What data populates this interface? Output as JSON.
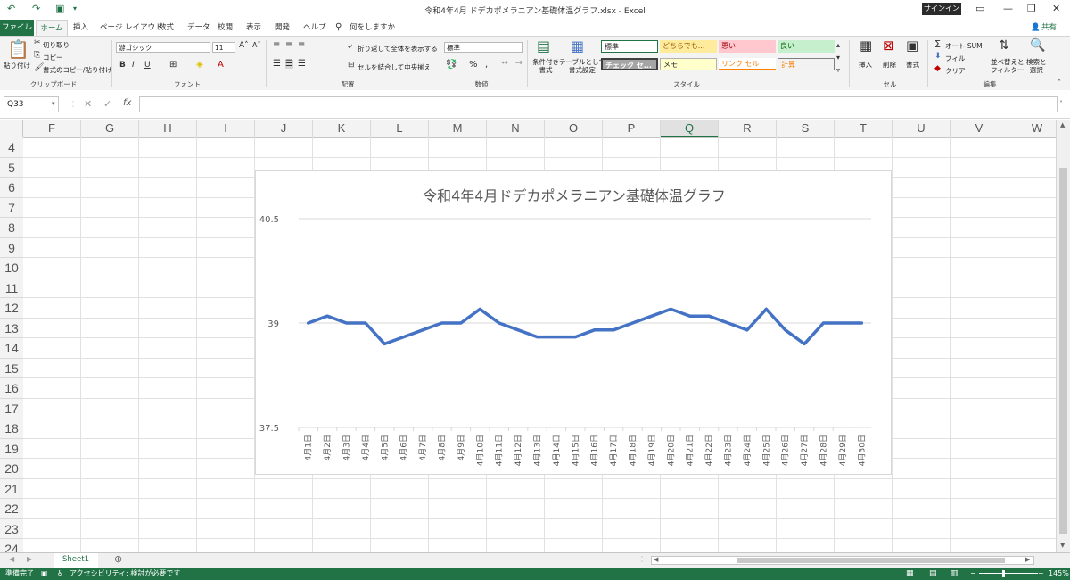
{
  "window": {
    "title": "令和4年4月 ドデカポメラニアン基礎体温グラフ.xlsx  -  Excel",
    "signin": "サインイン",
    "share": "共有"
  },
  "tabs": [
    "ファイル",
    "ホーム",
    "挿入",
    "ページ レイアウト",
    "数式",
    "データ",
    "校閲",
    "表示",
    "開発",
    "ヘルプ",
    "何をしますか"
  ],
  "ribbon": {
    "clipboard": {
      "paste": "貼り付け",
      "cut": "切り取り",
      "copy": "コピー",
      "format_painter": "書式のコピー/貼り付け",
      "label": "クリップボード"
    },
    "font": {
      "name": "游ゴシック",
      "size": "11",
      "label": "フォント"
    },
    "alignment": {
      "wrap": "折り返して全体を表示する",
      "merge": "セルを結合して中央揃え",
      "label": "配置"
    },
    "number": {
      "format": "標準",
      "label": "数値"
    },
    "styles": {
      "conditional": "条件付き\n書式",
      "table": "テーブルとして\n書式設定",
      "label": "スタイル",
      "cells": [
        "標準",
        "どちらでも...",
        "悪い",
        "良い",
        "チェック セ...",
        "メモ",
        "リンク セル",
        "計算"
      ]
    },
    "cells": {
      "insert": "挿入",
      "delete": "削除",
      "format": "書式",
      "label": "セル"
    },
    "editing": {
      "autosum": "オート SUM",
      "fill": "フィル",
      "clear": "クリア",
      "sort": "並べ替えと\nフィルター",
      "find": "検索と\n選択",
      "label": "編集"
    }
  },
  "formula_bar": {
    "name_box": "Q33",
    "formula": ""
  },
  "columns": [
    "F",
    "G",
    "H",
    "I",
    "J",
    "K",
    "L",
    "M",
    "N",
    "O",
    "P",
    "Q",
    "R",
    "S",
    "T",
    "U",
    "V",
    "W"
  ],
  "active_column": "Q",
  "rows": [
    "4",
    "5",
    "6",
    "7",
    "8",
    "9",
    "10",
    "11",
    "12",
    "13",
    "14",
    "15",
    "16",
    "17",
    "18",
    "19",
    "20",
    "21",
    "22",
    "23",
    "24"
  ],
  "chart_data": {
    "type": "line",
    "title": "令和4年4月ドデカポメラニアン基礎体温グラフ",
    "categories": [
      "4月1日",
      "4月2日",
      "4月3日",
      "4月4日",
      "4月5日",
      "4月6日",
      "4月7日",
      "4月8日",
      "4月9日",
      "4月10日",
      "4月11日",
      "4月12日",
      "4月13日",
      "4月14日",
      "4月15日",
      "4月16日",
      "4月17日",
      "4月18日",
      "4月19日",
      "4月20日",
      "4月21日",
      "4月22日",
      "4月23日",
      "4月24日",
      "4月25日",
      "4月26日",
      "4月27日",
      "4月28日",
      "4月29日",
      "4月30日"
    ],
    "values": [
      39.0,
      39.1,
      39.0,
      39.0,
      38.7,
      38.8,
      38.9,
      39.0,
      39.0,
      39.2,
      39.0,
      38.9,
      38.8,
      38.8,
      38.8,
      38.9,
      38.9,
      39.0,
      39.1,
      39.2,
      39.1,
      39.1,
      39.0,
      38.9,
      39.2,
      38.9,
      38.7,
      39.0,
      39.0,
      39.0
    ],
    "ylim": [
      37.5,
      40.5
    ],
    "yticks": [
      "40.5",
      "39",
      "37.5"
    ],
    "line_color": "#4472c4",
    "grid": true
  },
  "sheets": [
    "Sheet1"
  ],
  "status": {
    "ready": "準備完了",
    "accessibility": "アクセシビリティ: 検討が必要です",
    "zoom": "145%"
  }
}
